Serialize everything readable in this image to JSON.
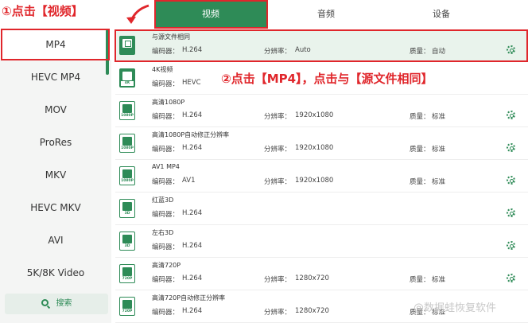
{
  "tabs": {
    "video": "视频",
    "audio": "音频",
    "device": "设备"
  },
  "sidebar": {
    "items": [
      {
        "label": "MP4"
      },
      {
        "label": "HEVC MP4"
      },
      {
        "label": "MOV"
      },
      {
        "label": "ProRes"
      },
      {
        "label": "MKV"
      },
      {
        "label": "HEVC MKV"
      },
      {
        "label": "AVI"
      },
      {
        "label": "5K/8K Video"
      }
    ],
    "search_label": "搜索"
  },
  "labels": {
    "encoder": "编码器：",
    "resolution": "分辨率：",
    "quality": "质量："
  },
  "formats": [
    {
      "title": "与源文件相同",
      "icon_badge": "",
      "encoder": "H.264",
      "resolution": "Auto",
      "quality": "自动",
      "icon": "same-as-source-icon"
    },
    {
      "title": "4K视频",
      "icon_badge": "4K",
      "encoder": "HEVC",
      "resolution": "",
      "quality": "",
      "icon": "4k-video-icon"
    },
    {
      "title": "高清1080P",
      "icon_badge": "1080P",
      "encoder": "H.264",
      "resolution": "1920x1080",
      "quality": "标准",
      "icon": "1080p-icon"
    },
    {
      "title": "高清1080P自动修正分辨率",
      "icon_badge": "1080P",
      "encoder": "H.264",
      "resolution": "1920x1080",
      "quality": "标准",
      "icon": "1080p-icon"
    },
    {
      "title": "AV1 MP4",
      "icon_badge": "1080P",
      "encoder": "AV1",
      "resolution": "1920x1080",
      "quality": "标准",
      "icon": "1080p-icon"
    },
    {
      "title": "红蓝3D",
      "icon_badge": "3D",
      "encoder": "H.264",
      "resolution": "",
      "quality": "",
      "icon": "3d-icon"
    },
    {
      "title": "左右3D",
      "icon_badge": "3D",
      "encoder": "H.264",
      "resolution": "",
      "quality": "",
      "icon": "3d-icon"
    },
    {
      "title": "高清720P",
      "icon_badge": "720P",
      "encoder": "H.264",
      "resolution": "1280x720",
      "quality": "标准",
      "icon": "720p-icon"
    },
    {
      "title": "高清720P自动修正分辨率",
      "icon_badge": "720P",
      "encoder": "H.264",
      "resolution": "1280x720",
      "quality": "标准",
      "icon": "720p-icon"
    }
  ],
  "annotations": {
    "step1": "①点击【视频】",
    "step2": "②点击【MP4】，点击与【源文件相同】"
  },
  "watermark": "@数据蛙恢复软件",
  "colors": {
    "accent": "#2e8b57",
    "annotation": "#e0262b",
    "selected_row": "#e9f3ec"
  }
}
